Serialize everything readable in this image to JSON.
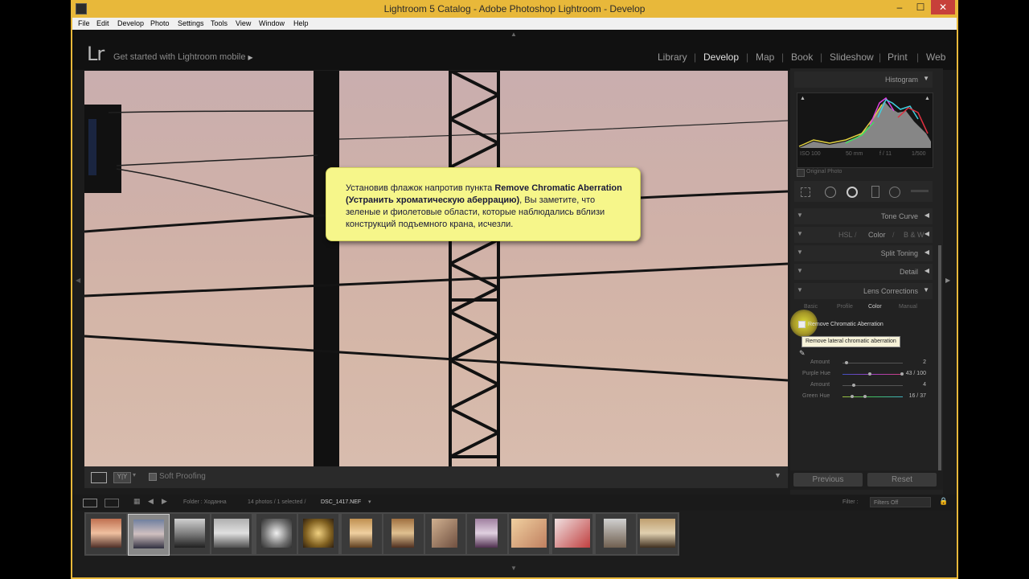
{
  "window": {
    "title": "Lightroom 5 Catalog - Adobe Photoshop Lightroom - Develop",
    "minimize": "–",
    "maximize": "☐",
    "close": "✕"
  },
  "menu": [
    "File",
    "Edit",
    "Develop",
    "Photo",
    "Settings",
    "Tools",
    "View",
    "Window",
    "Help"
  ],
  "topbar": {
    "logo": "Lr",
    "get_started": "Get started with Lightroom mobile",
    "modules": [
      "Library",
      "Develop",
      "Map",
      "Book",
      "Slideshow",
      "Print",
      "Web"
    ],
    "active_module": "Develop"
  },
  "callout": {
    "text_before": "Установив флажок напротив пункта ",
    "text_bold": "Remove Chromatic Aberration (Устранить хроматическую аберрацию)",
    "text_after": ", Вы заметите, что зеленые и фиолетовые области, которые наблюдались вблизи конструкций подъемного крана, исчезли."
  },
  "toolbar": {
    "soft_proofing": "Soft Proofing"
  },
  "histogram": {
    "title": "Histogram",
    "iso": "ISO 100",
    "focal": "50 mm",
    "aperture": "f / 11",
    "shutter": "1/500",
    "original_photo": "Original Photo"
  },
  "panels": {
    "tone_curve": "Tone Curve",
    "hsl": "HSL",
    "color": "Color",
    "bw": "B & W",
    "split_toning": "Split Toning",
    "detail": "Detail",
    "lens_corrections": "Lens Corrections"
  },
  "lens": {
    "tabs": [
      "Basic",
      "Profile",
      "Color",
      "Manual"
    ],
    "active_tab": "Color",
    "remove_ca": "Remove Chromatic Aberration",
    "tooltip": "Remove lateral chromatic aberration",
    "sliders": [
      {
        "label": "Amount",
        "value": "2",
        "level": 0.1
      },
      {
        "label": "Purple Hue",
        "value": "43 / 100",
        "level_low": 0.43,
        "level_high": 1.0
      },
      {
        "label": "Amount",
        "value": "4",
        "level": 0.2
      },
      {
        "label": "Green Hue",
        "value": "16 / 37",
        "level_low": 0.16,
        "level_high": 0.37
      }
    ]
  },
  "buttons": {
    "previous": "Previous",
    "reset": "Reset"
  },
  "filmstrip_bar": {
    "folder": "Folder : Ходанна",
    "count": "14 photos / 1 selected /",
    "file": "DSC_1417.NEF",
    "filter_label": "Filter :",
    "filter_value": "Filters Off"
  },
  "colors": {
    "accent_yellow": "#e8b83a",
    "callout_bg": "#f6f68a"
  }
}
